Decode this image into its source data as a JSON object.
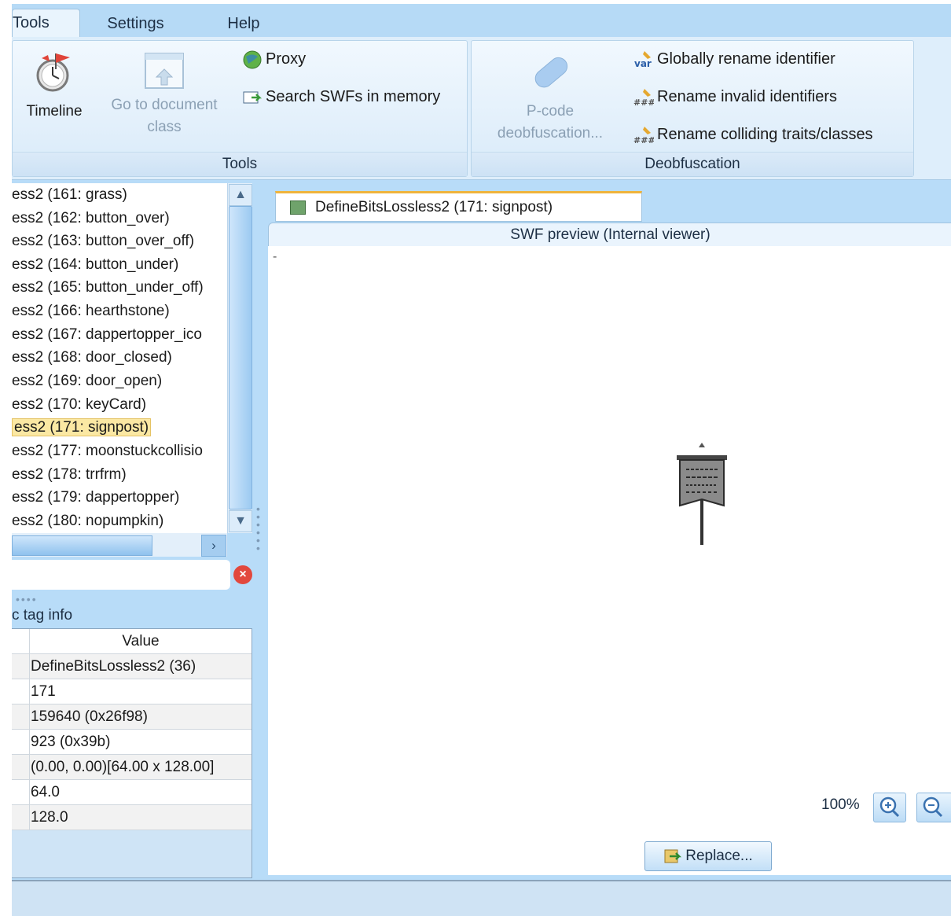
{
  "ribbon_tabs": [
    "Tools",
    "Settings",
    "Help"
  ],
  "tools_group": {
    "title": "Tools",
    "timeline_label": "Timeline",
    "go_to_document_label_1": "Go to document",
    "go_to_document_label_2": "class",
    "proxy_label": "Proxy",
    "search_swfs_label": "Search SWFs in memory"
  },
  "deobfuscation_group": {
    "title": "Deobfuscation",
    "pcode_label_1": "P-code",
    "pcode_label_2": "deobfuscation...",
    "globally_rename_label": "Globally rename identifier",
    "rename_invalid_label": "Rename invalid identifiers",
    "rename_colliding_label": "Rename colliding traits/classes"
  },
  "tree": {
    "items": [
      "ess2 (161: grass)",
      "ess2 (162: button_over)",
      "ess2 (163: button_over_off)",
      "ess2 (164: button_under)",
      "ess2 (165: button_under_off)",
      "ess2 (166: hearthstone)",
      "ess2 (167: dappertopper_ico",
      "ess2 (168: door_closed)",
      "ess2 (169: door_open)",
      "ess2 (170: keyCard)",
      "ess2 (171: signpost)",
      "ess2 (177: moonstuckcollisio",
      "ess2 (178: trrfrm)",
      "ess2 (179: dappertopper)",
      "ess2 (180: nopumpkin)"
    ],
    "selected_index": 10
  },
  "tag_info": {
    "title": "c tag info",
    "value_header": "Value",
    "values": [
      "DefineBitsLossless2 (36)",
      "171",
      "159640 (0x26f98)",
      "923 (0x39b)",
      "(0.00, 0.00)[64.00 x 128.00]",
      "64.0",
      "128.0"
    ]
  },
  "preview": {
    "doc_tab_label": "DefineBitsLossless2 (171: signpost)",
    "header_label": "SWF preview (Internal viewer)",
    "dash": "-",
    "zoom_level": "100%",
    "replace_label": "Replace..."
  },
  "colors": {
    "ribbon_bg": "#deeefb",
    "main_bg": "#b8dcf8",
    "selection": "#fbe8a3",
    "accent_tab": "#f0b43c"
  }
}
